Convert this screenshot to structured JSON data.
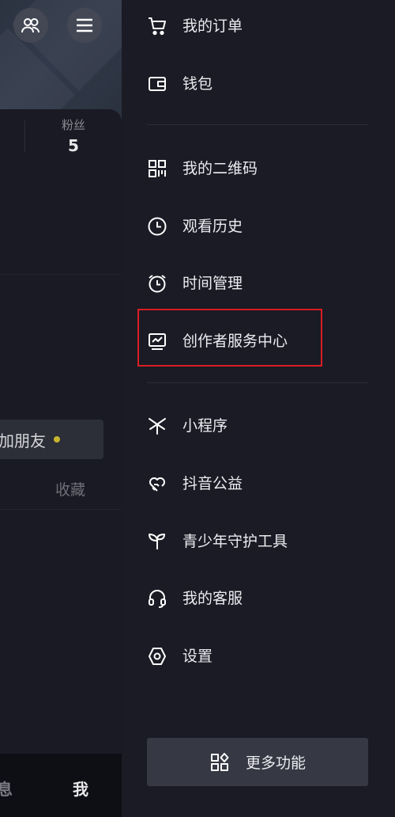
{
  "profile_bg": {
    "stats": {
      "fans_label": "粉丝",
      "fans_count": "5"
    },
    "add_friend_label": "加朋友",
    "collect_label": "收藏",
    "bottom_nav": {
      "messages_label": "息",
      "me_label": "我"
    }
  },
  "drawer": {
    "group1": [
      {
        "label": "我的订单",
        "icon": "cart-icon"
      },
      {
        "label": "钱包",
        "icon": "wallet-icon"
      }
    ],
    "group2": [
      {
        "label": "我的二维码",
        "icon": "qr-code-icon"
      },
      {
        "label": "观看历史",
        "icon": "clock-icon"
      },
      {
        "label": "时间管理",
        "icon": "alarm-clock-icon"
      },
      {
        "label": "创作者服务中心",
        "icon": "monitor-chart-icon"
      }
    ],
    "group3": [
      {
        "label": "小程序",
        "icon": "mini-program-icon"
      },
      {
        "label": "抖音公益",
        "icon": "heart-hands-icon"
      },
      {
        "label": "青少年守护工具",
        "icon": "sprout-icon"
      },
      {
        "label": "我的客服",
        "icon": "headset-icon"
      },
      {
        "label": "设置",
        "icon": "settings-icon"
      }
    ],
    "more_button_label": "更多功能",
    "highlight_color": "#d81e22"
  }
}
